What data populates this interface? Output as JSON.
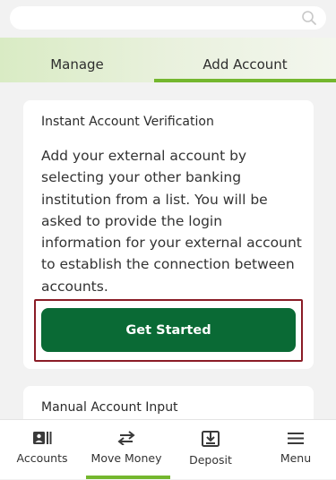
{
  "search": {
    "placeholder": "",
    "icon": "search-icon"
  },
  "tabs": [
    {
      "label": "Manage",
      "active": false
    },
    {
      "label": "Add Account",
      "active": true
    }
  ],
  "colors": {
    "accent": "#74b72e",
    "primary_button": "#0a6a35",
    "highlight_border": "#8a1c26"
  },
  "instant_card": {
    "title": "Instant Account Verification",
    "body": "Add your external account by selecting your other banking institution from a list. You will be asked to provide the login information for your external account to establish the connection between accounts.",
    "button_label": "Get Started"
  },
  "manual_card": {
    "title": "Manual Account Input"
  },
  "bottom_nav": [
    {
      "label": "Accounts",
      "icon": "accounts-icon",
      "active": false
    },
    {
      "label": "Move Money",
      "icon": "transfer-arrows-icon",
      "active": true
    },
    {
      "label": "Deposit",
      "icon": "deposit-icon",
      "active": false
    },
    {
      "label": "Menu",
      "icon": "hamburger-menu-icon",
      "active": false
    }
  ]
}
